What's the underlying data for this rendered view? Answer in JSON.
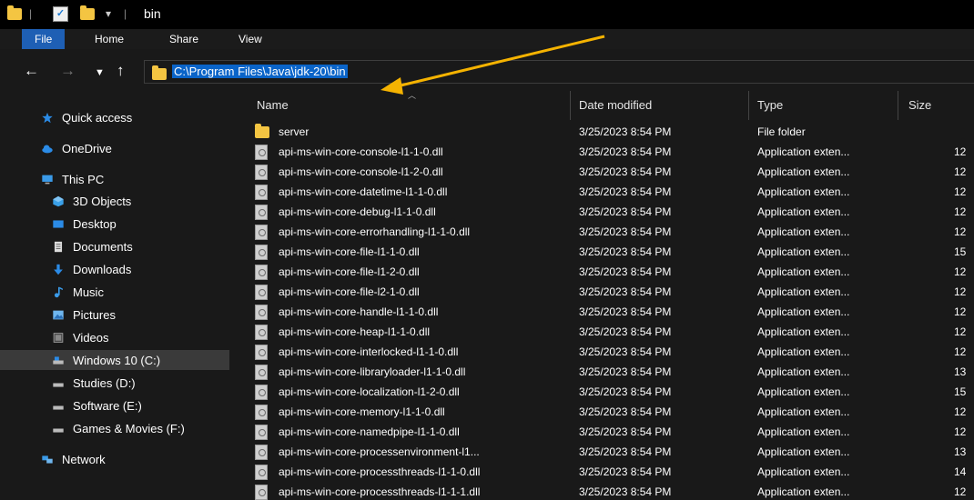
{
  "window": {
    "title": "bin"
  },
  "ribbon": {
    "tabs": [
      "File",
      "Home",
      "Share",
      "View"
    ]
  },
  "navigation": {
    "back_icon": "arrow-left",
    "forward_icon": "arrow-right",
    "recent_icon": "chevron-down",
    "up_icon": "arrow-up"
  },
  "address_bar": {
    "path": "C:\\Program Files\\Java\\jdk-20\\bin"
  },
  "annotation": {
    "arrow_color": "#f5b301"
  },
  "sidebar": {
    "items": [
      {
        "label": "Quick access",
        "icon": "star-icon"
      },
      {
        "label": "OneDrive",
        "icon": "cloud-icon"
      },
      {
        "label": "This PC",
        "icon": "computer-icon"
      },
      {
        "label": "3D Objects",
        "icon": "cube-icon"
      },
      {
        "label": "Desktop",
        "icon": "desktop-icon"
      },
      {
        "label": "Documents",
        "icon": "document-icon"
      },
      {
        "label": "Downloads",
        "icon": "download-icon"
      },
      {
        "label": "Music",
        "icon": "music-icon"
      },
      {
        "label": "Pictures",
        "icon": "pictures-icon"
      },
      {
        "label": "Videos",
        "icon": "video-icon"
      },
      {
        "label": "Windows 10 (C:)",
        "icon": "drive-icon",
        "selected": true
      },
      {
        "label": "Studies (D:)",
        "icon": "drive-icon"
      },
      {
        "label": "Software (E:)",
        "icon": "drive-icon"
      },
      {
        "label": "Games & Movies (F:)",
        "icon": "drive-icon"
      },
      {
        "label": "Network",
        "icon": "network-icon"
      }
    ]
  },
  "columns": [
    "Name",
    "Date modified",
    "Type",
    "Size"
  ],
  "files": [
    {
      "name": "server",
      "date": "3/25/2023 8:54 PM",
      "type": "File folder",
      "size": "",
      "kind": "folder"
    },
    {
      "name": "api-ms-win-core-console-l1-1-0.dll",
      "date": "3/25/2023 8:54 PM",
      "type": "Application exten...",
      "size": "12",
      "kind": "dll"
    },
    {
      "name": "api-ms-win-core-console-l1-2-0.dll",
      "date": "3/25/2023 8:54 PM",
      "type": "Application exten...",
      "size": "12",
      "kind": "dll"
    },
    {
      "name": "api-ms-win-core-datetime-l1-1-0.dll",
      "date": "3/25/2023 8:54 PM",
      "type": "Application exten...",
      "size": "12",
      "kind": "dll"
    },
    {
      "name": "api-ms-win-core-debug-l1-1-0.dll",
      "date": "3/25/2023 8:54 PM",
      "type": "Application exten...",
      "size": "12",
      "kind": "dll"
    },
    {
      "name": "api-ms-win-core-errorhandling-l1-1-0.dll",
      "date": "3/25/2023 8:54 PM",
      "type": "Application exten...",
      "size": "12",
      "kind": "dll"
    },
    {
      "name": "api-ms-win-core-file-l1-1-0.dll",
      "date": "3/25/2023 8:54 PM",
      "type": "Application exten...",
      "size": "15",
      "kind": "dll"
    },
    {
      "name": "api-ms-win-core-file-l1-2-0.dll",
      "date": "3/25/2023 8:54 PM",
      "type": "Application exten...",
      "size": "12",
      "kind": "dll"
    },
    {
      "name": "api-ms-win-core-file-l2-1-0.dll",
      "date": "3/25/2023 8:54 PM",
      "type": "Application exten...",
      "size": "12",
      "kind": "dll"
    },
    {
      "name": "api-ms-win-core-handle-l1-1-0.dll",
      "date": "3/25/2023 8:54 PM",
      "type": "Application exten...",
      "size": "12",
      "kind": "dll"
    },
    {
      "name": "api-ms-win-core-heap-l1-1-0.dll",
      "date": "3/25/2023 8:54 PM",
      "type": "Application exten...",
      "size": "12",
      "kind": "dll"
    },
    {
      "name": "api-ms-win-core-interlocked-l1-1-0.dll",
      "date": "3/25/2023 8:54 PM",
      "type": "Application exten...",
      "size": "12",
      "kind": "dll"
    },
    {
      "name": "api-ms-win-core-libraryloader-l1-1-0.dll",
      "date": "3/25/2023 8:54 PM",
      "type": "Application exten...",
      "size": "13",
      "kind": "dll"
    },
    {
      "name": "api-ms-win-core-localization-l1-2-0.dll",
      "date": "3/25/2023 8:54 PM",
      "type": "Application exten...",
      "size": "15",
      "kind": "dll"
    },
    {
      "name": "api-ms-win-core-memory-l1-1-0.dll",
      "date": "3/25/2023 8:54 PM",
      "type": "Application exten...",
      "size": "12",
      "kind": "dll"
    },
    {
      "name": "api-ms-win-core-namedpipe-l1-1-0.dll",
      "date": "3/25/2023 8:54 PM",
      "type": "Application exten...",
      "size": "12",
      "kind": "dll"
    },
    {
      "name": "api-ms-win-core-processenvironment-l1...",
      "date": "3/25/2023 8:54 PM",
      "type": "Application exten...",
      "size": "13",
      "kind": "dll"
    },
    {
      "name": "api-ms-win-core-processthreads-l1-1-0.dll",
      "date": "3/25/2023 8:54 PM",
      "type": "Application exten...",
      "size": "14",
      "kind": "dll"
    },
    {
      "name": "api-ms-win-core-processthreads-l1-1-1.dll",
      "date": "3/25/2023 8:54 PM",
      "type": "Application exten...",
      "size": "12",
      "kind": "dll"
    }
  ]
}
